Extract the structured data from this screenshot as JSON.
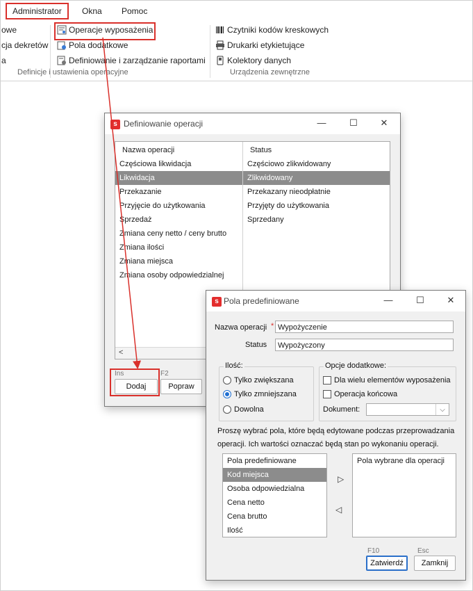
{
  "ribbon": {
    "tabs": [
      "Administrator",
      "Okna",
      "Pomoc"
    ],
    "left_partial": [
      "owe",
      "cja dekretów",
      "a"
    ],
    "group1": {
      "items": [
        "Operacje wyposażenia",
        "Pola dodatkowe",
        "Definiowanie i zarządzanie raportami"
      ],
      "label": "Definicje i ustawienia operacyjne"
    },
    "group2": {
      "items": [
        "Czytniki kodów kreskowych",
        "Drukarki etykietujące",
        "Kolektory danych"
      ],
      "label": "Urządzenia zewnętrzne"
    }
  },
  "def_window": {
    "title": "Definiowanie operacji",
    "columns": [
      "Nazwa operacji",
      "Status"
    ],
    "rows": [
      {
        "name": "Częściowa likwidacja",
        "status": "Częściowo zlikwidowany"
      },
      {
        "name": "Likwidacja",
        "status": "Zlikwidowany"
      },
      {
        "name": "Przekazanie",
        "status": "Przekazany nieodpłatnie"
      },
      {
        "name": "Przyjęcie do użytkowania",
        "status": "Przyjęty do użytkowania"
      },
      {
        "name": "Sprzedaż",
        "status": "Sprzedany"
      },
      {
        "name": "Zmiana ceny netto / ceny brutto",
        "status": ""
      },
      {
        "name": "Zmiana ilości",
        "status": ""
      },
      {
        "name": "Zmiana miejsca",
        "status": ""
      },
      {
        "name": "Zmiana osoby odpowiedzialnej",
        "status": ""
      }
    ],
    "scroll_left": "<",
    "add_hint": "Ins",
    "add_label": "Dodaj",
    "edit_hint": "F2",
    "edit_label": "Popraw"
  },
  "pola_window": {
    "title": "Pola predefiniowane",
    "nazwa_label": "Nazwa operacji",
    "required_mark": "*",
    "nazwa_value": "Wypożyczenie",
    "status_label": "Status",
    "status_value": "Wypożyczony",
    "ilosc_legend": "Ilość:",
    "ilosc_options": [
      "Tylko zwiększana",
      "Tylko zmniejszana",
      "Dowolna"
    ],
    "opcje_legend": "Opcje dodatkowe:",
    "opcje_checks": [
      "Dla wielu elementów wyposażenia",
      "Operacja końcowa"
    ],
    "dokument_label": "Dokument:",
    "dokument_value": "",
    "info_line1": "Proszę wybrać pola, które będą edytowane podczas przeprowadzania",
    "info_line2": "operacji. Ich wartości oznaczać będą stan po wykonaniu operacji.",
    "left_list_header": "Pola predefiniowane",
    "left_list_items": [
      "Kod miejsca",
      "Osoba odpowiedzialna",
      "Cena netto",
      "Cena brutto",
      "Ilość"
    ],
    "right_list_header": "Pola wybrane dla operacji",
    "move_right": "▷",
    "move_left": "◁",
    "ok_hint": "F10",
    "ok_label": "Zatwierdź",
    "cancel_hint": "Esc",
    "cancel_label": "Zamknij"
  },
  "colors": {
    "highlight": "#d9302b",
    "selection": "#8c8c8c",
    "accent": "#1f6fd1"
  }
}
